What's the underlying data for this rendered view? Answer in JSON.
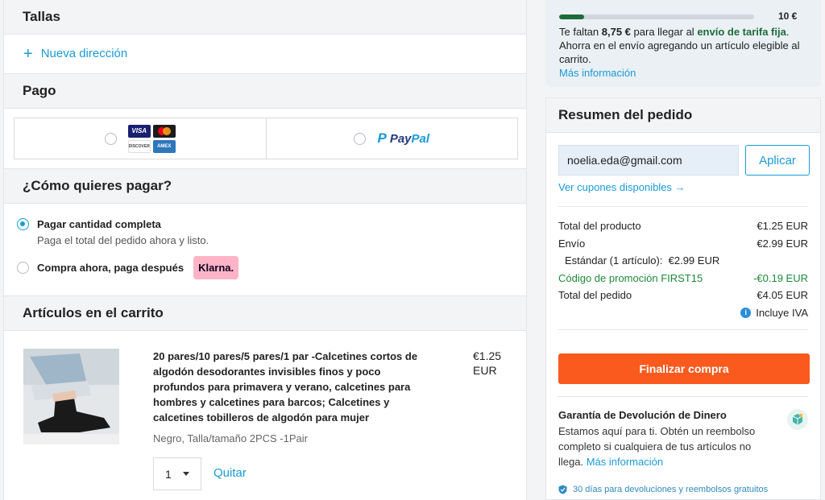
{
  "address": {
    "section_title": "Tallas",
    "new_address_label": "Nueva dirección"
  },
  "payment": {
    "section_title": "Pago",
    "card_logos": [
      "VISA",
      "MC",
      "DISCOVER",
      "AMEX"
    ],
    "paypal_label_pay": "Pay",
    "paypal_label_pal": "Pal"
  },
  "how_to_pay": {
    "section_title": "¿Cómo quieres pagar?",
    "full_label": "Pagar cantidad completa",
    "full_sub": "Paga el total del pedido ahora y listo.",
    "later_label": "Compra ahora, paga después",
    "klarna_label": "Klarna."
  },
  "cart": {
    "section_title": "Artículos en el carrito",
    "item": {
      "title": "20 pares/10 pares/5 pares/1 par -Calcetines cortos de algodón desodorantes invisibles finos y poco profundos para primavera y verano, calcetines para hombres y calcetines para barcos; Calcetines y calcetines tobilleros de algodón para mujer",
      "price": "€1.25 EUR",
      "variant": "Negro, Talla/tamaño 2PCS -1Pair",
      "quantity": "1",
      "remove_label": "Quitar"
    }
  },
  "shipping": {
    "progress_fraction": 0.13,
    "target_amount": "10 €",
    "text_1": "Te faltan ",
    "missing_amount": "8,75 €",
    "text_2": " para llegar al ",
    "fixed_rate": "envío de tarifa fija",
    "text_3": ". Ahorra en el envío agregando un artículo elegible al carrito.",
    "more_info": "Más información"
  },
  "summary": {
    "title": "Resumen del pedido",
    "coupon_value": "noelia.eda@gmail.com",
    "apply_label": "Aplicar",
    "see_coupons": "Ver cupones disponibles →",
    "lines": {
      "product_label": "Total del producto",
      "product_value": "€1.25 EUR",
      "shipping_label": "Envío",
      "shipping_value": "€2.99 EUR",
      "standard_label": "Estándar (1 artículo):",
      "standard_value": "€2.99 EUR",
      "promo_label": "Código de promoción FIRST15",
      "promo_value": "-€0.19 EUR",
      "total_label": "Total del pedido",
      "total_value": "€4.05 EUR",
      "iva_label": "Incluye IVA"
    },
    "checkout_label": "Finalizar compra",
    "guarantee": {
      "title": "Garantía de Devolución de Dinero",
      "body": "Estamos aquí para ti. Obtén un reembolso completo si cualquiera de tus artículos no llega.",
      "more_info": "Más información"
    },
    "returns_label": "30 días para devoluciones y reembolsos gratuitos"
  },
  "colors": {
    "accent": "#1a9bd7",
    "checkout": "#fa5a1e",
    "promo_green": "#1d8a3a",
    "klarna_pink": "#ffb3c7"
  }
}
